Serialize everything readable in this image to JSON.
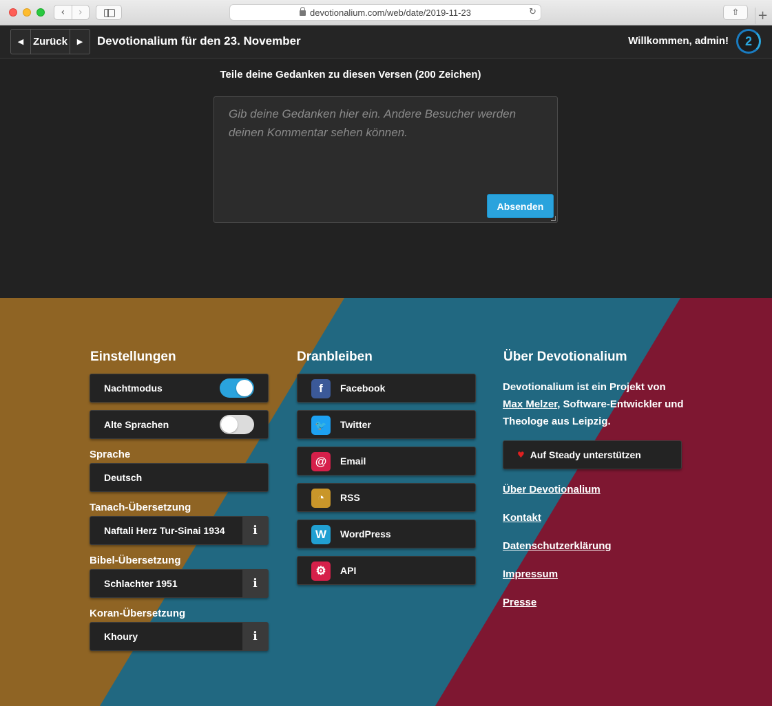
{
  "browser": {
    "url": "devotionalium.com/web/date/2019-11-23",
    "back_icon": "‹",
    "forward_icon": "›",
    "reload_icon": "↻",
    "share_icon": "⇧",
    "newtab_icon": "+"
  },
  "header": {
    "prev_icon": "◀",
    "back_label": "Zurück",
    "next_icon": "▶",
    "title": "Devotionalium für den 23. November",
    "welcome": "Willkommen, admin!",
    "streak": "2"
  },
  "comment": {
    "heading": "Teile deine Gedanken zu diesen Versen (200 Zeichen)",
    "placeholder": "Gib deine Gedanken hier ein. Andere Besucher werden deinen Kommentar sehen können.",
    "submit_label": "Absenden"
  },
  "settings": {
    "title": "Einstellungen",
    "night_mode": {
      "label": "Nachtmodus",
      "on": true
    },
    "old_languages": {
      "label": "Alte Sprachen",
      "on": false
    },
    "language_label": "Sprache",
    "language_value": "Deutsch",
    "tanach_label": "Tanach-Übersetzung",
    "tanach_value": "Naftali Herz Tur-Sinai 1934",
    "bible_label": "Bibel-Übersetzung",
    "bible_value": "Schlachter 1951",
    "quran_label": "Koran-Übersetzung",
    "quran_value": "Khoury",
    "info_glyph": "i"
  },
  "stay": {
    "title": "Dranbleiben",
    "items": [
      {
        "label": "Facebook",
        "glyph": "f",
        "color": "#3b5998",
        "icon": "facebook-icon"
      },
      {
        "label": "Twitter",
        "glyph": "🐦",
        "color": "#1da1f2",
        "icon": "twitter-icon"
      },
      {
        "label": "Email",
        "glyph": "@",
        "color": "#d6204a",
        "icon": "email-icon"
      },
      {
        "label": "RSS",
        "glyph": "◔",
        "color": "#c9962a",
        "icon": "rss-icon"
      },
      {
        "label": "WordPress",
        "glyph": "W",
        "color": "#21a0d2",
        "icon": "wordpress-icon"
      },
      {
        "label": "API",
        "glyph": "⚙",
        "color": "#d6204a",
        "icon": "gears-icon"
      }
    ]
  },
  "about": {
    "title": "Über Devotionalium",
    "text_before": "Devotionalium ist ein Projekt von ",
    "author": "Max Melzer",
    "text_after": ", Software-Entwickler und Theologe aus Leipzig.",
    "support_label": "Auf Steady unterstützen",
    "heart": "♥",
    "links": [
      "Über Devotionalium",
      "Kontakt",
      "Datenschutzerklärung",
      "Impressum",
      "Presse"
    ]
  },
  "colors": {
    "gold": "#8f6424",
    "teal": "#216881",
    "crimson": "#7e1731",
    "accent": "#2aa3dd"
  }
}
